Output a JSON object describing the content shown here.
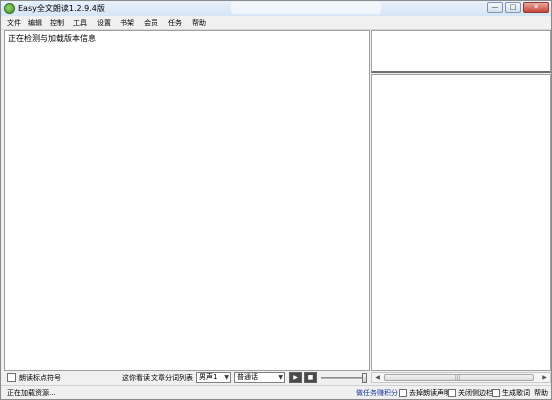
{
  "window": {
    "title": "Easy全文朗读1.2.9.4版",
    "minimize_label": "—",
    "maximize_label": "□",
    "close_label": "✕"
  },
  "menu": {
    "items": [
      "文件",
      "编辑",
      "控制",
      "工具",
      "设置",
      "书架",
      "会员",
      "任务",
      "帮助"
    ]
  },
  "main": {
    "text": "正在检测与加载版本信息"
  },
  "controls": {
    "read_punctuation_label": "朗读标点符号",
    "follow_reading_label": "这你看读",
    "word_list_label": "文章分词列表",
    "voice_select": "男声1",
    "dialect_select": "普通话",
    "play_label": "▶",
    "stop_label": "■"
  },
  "status": {
    "loading_text": "正在加载资源...",
    "task_link": "做任务赚积分",
    "remove_notice_label": "去掉朗读声明",
    "close_sidebar_label": "关闭侧边栏",
    "generate_words_label": "生成歌词",
    "help_label": "帮助"
  },
  "icons": {
    "dropdown": "▼",
    "scroll_left": "◀",
    "scroll_right": "▶",
    "grip": "|||"
  }
}
